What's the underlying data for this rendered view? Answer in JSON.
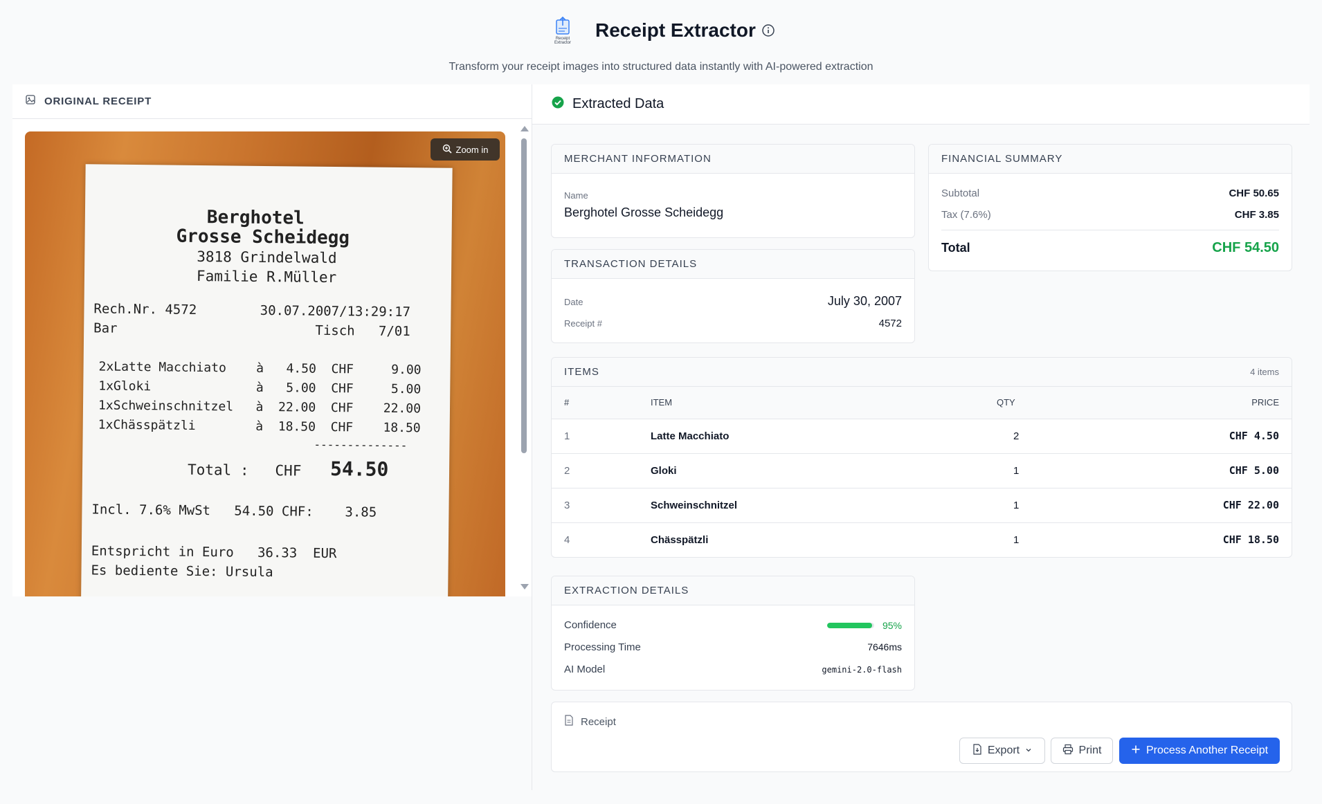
{
  "app": {
    "title": "Receipt Extractor",
    "tagline": "Transform your receipt images into structured data instantly with AI-powered extraction",
    "logo_text_1": "Receipt",
    "logo_text_2": "Extractor"
  },
  "left": {
    "header": "ORIGINAL RECEIPT",
    "zoom_label": "Zoom in",
    "receipt_lines": {
      "l1": "Berghotel",
      "l2": "Grosse Scheidegg",
      "l3": "3818 Grindelwald",
      "l4": "Familie R.Müller",
      "l5": "Rech.Nr. 4572        30.07.2007/13:29:17",
      "l6": "Bar                         Tisch   7/01",
      "l7": "2xLatte Macchiato    à   4.50  CHF     9.00",
      "l8": "1xGloki              à   5.00  CHF     5.00",
      "l9": "1xSchweinschnitzel   à  22.00  CHF    22.00",
      "l10": "1xChässpätzli        à  18.50  CHF    18.50",
      "l11": "--------------",
      "l12": "Total :   CHF",
      "l12b": "54.50",
      "l13": "Incl. 7.6% MwSt   54.50 CHF:    3.85",
      "l14": "Entspricht in Euro   36.33  EUR",
      "l15": "Es bediente Sie: Ursula"
    }
  },
  "right": {
    "header": "Extracted Data",
    "merchant": {
      "title": "MERCHANT INFORMATION",
      "name_label": "Name",
      "name": "Berghotel Grosse Scheidegg"
    },
    "financial": {
      "title": "FINANCIAL SUMMARY",
      "subtotal_label": "Subtotal",
      "subtotal": "CHF 50.65",
      "tax_label": "Tax (7.6%)",
      "tax": "CHF 3.85",
      "total_label": "Total",
      "total": "CHF 54.50"
    },
    "transaction": {
      "title": "TRANSACTION DETAILS",
      "date_label": "Date",
      "date": "July 30, 2007",
      "receipt_label": "Receipt #",
      "receipt": "4572"
    },
    "items": {
      "title": "ITEMS",
      "count": "4 items",
      "columns": [
        "#",
        "ITEM",
        "QTY",
        "PRICE"
      ],
      "rows": [
        {
          "n": "1",
          "name": "Latte Macchiato",
          "qty": "2",
          "price": "CHF 4.50"
        },
        {
          "n": "2",
          "name": "Gloki",
          "qty": "1",
          "price": "CHF 5.00"
        },
        {
          "n": "3",
          "name": "Schweinschnitzel",
          "qty": "1",
          "price": "CHF 22.00"
        },
        {
          "n": "4",
          "name": "Chässpätzli",
          "qty": "1",
          "price": "CHF 18.50"
        }
      ]
    },
    "extraction": {
      "title": "EXTRACTION DETAILS",
      "confidence_label": "Confidence",
      "confidence": "95%",
      "confidence_value": 0.95,
      "time_label": "Processing Time",
      "time": "7646ms",
      "model_label": "AI Model",
      "model": "gemini-2.0-flash"
    },
    "footer": {
      "doc_label": "Receipt",
      "export_label": "Export",
      "print_label": "Print",
      "process_label": "Process Another Receipt"
    }
  },
  "colors": {
    "accent": "#2563eb",
    "success": "#16a34a",
    "progress": "#22c55e"
  },
  "icons": [
    "receipt-logo-icon",
    "info-icon",
    "image-icon",
    "zoom-in-icon",
    "check-circle-icon",
    "document-icon",
    "export-file-icon",
    "chevron-down-icon",
    "printer-icon",
    "plus-icon"
  ]
}
